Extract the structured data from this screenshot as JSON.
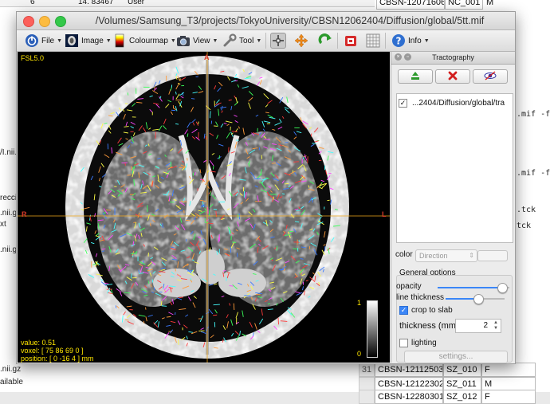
{
  "window": {
    "title": "/Volumes/Samsung_T3/projects/TokyoUniversity/CBSN12062404/Diffusion/global/5tt.mif"
  },
  "toolbar": {
    "items": [
      {
        "label": "File",
        "icon": "power-icon"
      },
      {
        "label": "Image",
        "icon": "image-icon"
      },
      {
        "label": "Colourmap",
        "icon": "colourmap-icon"
      },
      {
        "label": "View",
        "icon": "camera-icon"
      },
      {
        "label": "Tool",
        "icon": "wrench-icon"
      },
      {
        "label": "",
        "icon": "crosshair-icon"
      },
      {
        "label": "",
        "icon": "move-arrows-icon"
      },
      {
        "label": "",
        "icon": "rotate-icon"
      },
      {
        "label": "",
        "icon": "record-icon"
      },
      {
        "label": "",
        "icon": "grid-icon"
      },
      {
        "label": "Info",
        "icon": "help-icon"
      }
    ]
  },
  "viewer": {
    "top_left": "FSL5.0",
    "orient_left": "R",
    "orient_right": "L",
    "orient_top": "A",
    "value_line": "value: 0.51",
    "voxel_line": "voxel: [ 75 86 69 0 ]",
    "position_line": "position: [ 0 -16 4 ] mm",
    "colorbar_max": "1",
    "colorbar_min": "0"
  },
  "panel": {
    "title": "Tractography",
    "track_file": "...2404/Diffusion/global/tra",
    "color_label": "color",
    "color_mode": "Direction",
    "general_options": "General options",
    "opacity_label": "opacity",
    "opacity_value": 0.95,
    "line_thickness_label": "line thickness",
    "line_thickness_value": 0.55,
    "crop_label": "crop to slab",
    "thickness_label": "thickness (mm)",
    "thickness_value": "2",
    "lighting_label": "lighting",
    "settings_label": "settings..."
  },
  "background": {
    "top_values": [
      "6",
      "14. 83467",
      "User"
    ],
    "rows": [
      {
        "idx": "",
        "a": "CBSN-12071606",
        "b": "NC_001",
        "c": "M"
      },
      {
        "idx": "31",
        "a": "CBSN-12112503",
        "b": "SZ_010",
        "c": "F"
      },
      {
        "idx": "",
        "a": "CBSN-12122302",
        "b": "SZ_011",
        "c": "M"
      },
      {
        "idx": "",
        "a": "CBSN-12280301",
        "b": "SZ_012",
        "c": "F"
      }
    ],
    "term_lines": [
      ".mif -fis",
      ".mif -fis",
      ".tck",
      "tck"
    ],
    "left_lines": [
      "/I.nii.",
      "reccio",
      ".nii.g",
      "xt",
      ".nii.gz",
      ".nii.gz",
      "ailable"
    ]
  }
}
